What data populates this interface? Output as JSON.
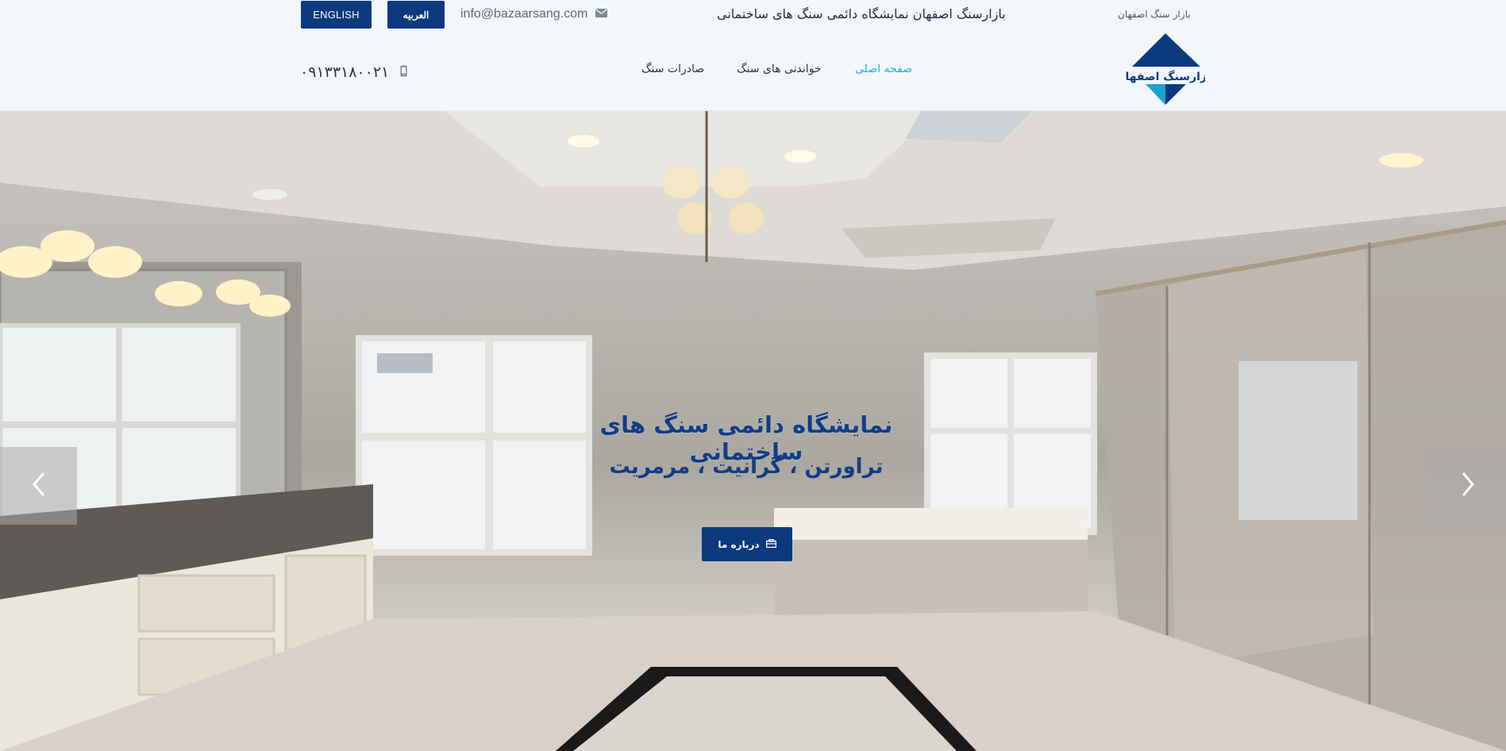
{
  "header": {
    "btn_english": "ENGLISH",
    "btn_arabic": "العربیه",
    "email": "info@bazaarsang.com",
    "title": "بازارسنگ اصفهان نمایشگاه دائمی سنگ های ساختمانی",
    "small_title": "بازار سنگ اصفهان",
    "phone": "۰۹۱۳۳۱۸۰۰۲۱",
    "nav": {
      "home": "صفحه اصلی",
      "hardness": "خواندنی های سنگ",
      "export": "صادرات سنگ"
    },
    "logo_text": "بازارسنگ اصفهان"
  },
  "hero": {
    "title": "نمایشگاه دائمی سنگ های ساختمانی",
    "subtitle": "تراورتن ، گرانیت ، مرمریت",
    "button_label": "درباره ما"
  },
  "icons": {
    "email": "envelope-icon",
    "phone": "mobile-phone-icon",
    "about": "briefcase-icon",
    "prev": "chevron-left-icon",
    "next": "chevron-right-icon"
  },
  "colors": {
    "brand": "#0d3a7e",
    "nav_active": "#1fb4d8",
    "hero_text": "#123c86"
  }
}
